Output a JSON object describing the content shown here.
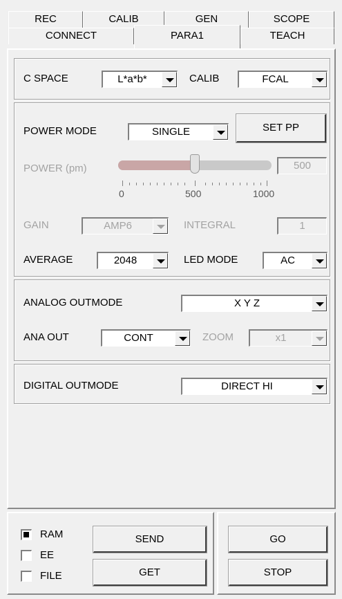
{
  "tabs_top": [
    "REC",
    "CALIB",
    "GEN",
    "SCOPE"
  ],
  "tabs_bottom": [
    "CONNECT",
    "PARA1",
    "TEACH"
  ],
  "active_tab": "PARA1",
  "cspace": {
    "label": "C SPACE",
    "value": "L*a*b*"
  },
  "calib": {
    "label": "CALIB",
    "value": "FCAL"
  },
  "power_mode": {
    "label": "POWER MODE",
    "value": "SINGLE",
    "set_button": "SET PP"
  },
  "power": {
    "label": "POWER (pm)",
    "value": "500",
    "level": 0.5,
    "ticks": [
      "0",
      "500",
      "1000"
    ]
  },
  "gain": {
    "label": "GAIN",
    "value": "AMP6"
  },
  "integral": {
    "label": "INTEGRAL",
    "value": "1"
  },
  "average": {
    "label": "AVERAGE",
    "value": "2048"
  },
  "led_mode": {
    "label": "LED MODE",
    "value": "AC"
  },
  "analog_outmode": {
    "label": "ANALOG OUTMODE",
    "value": "X Y Z"
  },
  "ana_out": {
    "label": "ANA OUT",
    "value": "CONT"
  },
  "zoom": {
    "label": "ZOOM",
    "value": "x1"
  },
  "digital_outmode": {
    "label": "DIGITAL OUTMODE",
    "value": "DIRECT HI"
  },
  "storage": {
    "ram": "RAM",
    "ee": "EE",
    "file": "FILE",
    "ram_checked": true,
    "ee_checked": false,
    "file_checked": false
  },
  "buttons": {
    "send": "SEND",
    "get": "GET",
    "go": "GO",
    "stop": "STOP"
  }
}
